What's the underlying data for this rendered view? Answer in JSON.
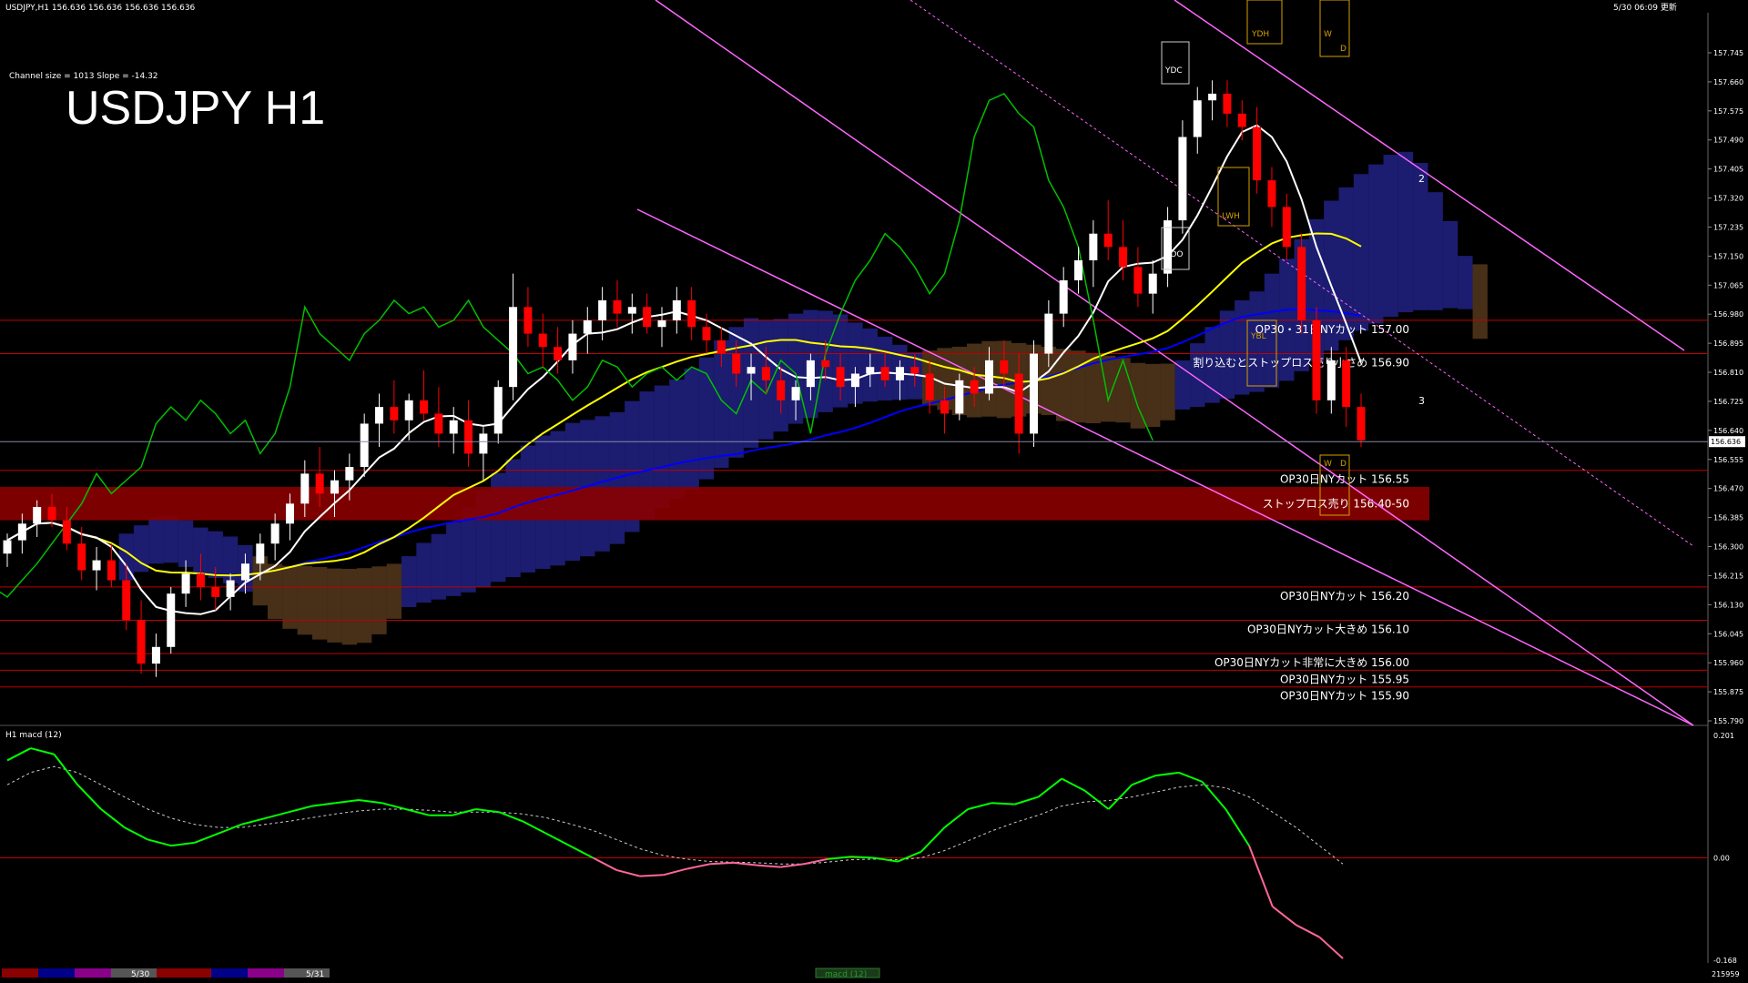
{
  "header": {
    "info_line": "USDJPY,H1  156.636 156.636 156.636 156.636",
    "timestamp": "5/30 06:09 更新"
  },
  "overlay": {
    "channel_info": "Channel size = 1013 Slope = -14.32",
    "big_title": "USDJPY H1"
  },
  "colors": {
    "background": "#000000",
    "bull_candle": "#ffffff",
    "bear_candle": "#ff0000",
    "ma_fast": "#ffffff",
    "ma_mid": "#ffff00",
    "ma_slow": "#0000ff",
    "chikou": "#00c000",
    "channel": "#ff66ff",
    "kumo_bull": "#3333cc",
    "kumo_bear": "#cc8844",
    "level_line": "#c00000",
    "stop_zone": "#8b0000",
    "macd_line_up": "#00ff00",
    "macd_line_down": "#ff6699"
  },
  "chart_data": [
    {
      "type": "candlestick",
      "symbol": "USDJPY",
      "timeframe": "H1",
      "ylim": [
        155.79,
        157.83
      ],
      "price_axis_ticks": [
        "157.745",
        "157.660",
        "157.575",
        "157.490",
        "157.405",
        "157.320",
        "157.235",
        "157.150",
        "157.065",
        "156.980",
        "156.895",
        "156.810",
        "156.725",
        "156.640",
        "156.555",
        "156.470",
        "156.385",
        "156.300",
        "156.215",
        "156.130",
        "156.045",
        "155.960",
        "155.875",
        "155.790"
      ],
      "current_price": "156.636",
      "x_labels": [
        "5/30",
        "5/31"
      ],
      "candles": [
        [
          156.3,
          156.36,
          156.26,
          156.34
        ],
        [
          156.34,
          156.42,
          156.3,
          156.39
        ],
        [
          156.39,
          156.46,
          156.35,
          156.44
        ],
        [
          156.44,
          156.48,
          156.38,
          156.4
        ],
        [
          156.4,
          156.44,
          156.31,
          156.33
        ],
        [
          156.33,
          156.38,
          156.22,
          156.25
        ],
        [
          156.25,
          156.32,
          156.19,
          156.28
        ],
        [
          156.28,
          156.33,
          156.2,
          156.22
        ],
        [
          156.22,
          156.27,
          156.07,
          156.1
        ],
        [
          156.1,
          156.16,
          155.94,
          155.97
        ],
        [
          155.97,
          156.06,
          155.93,
          156.02
        ],
        [
          156.02,
          156.2,
          156.0,
          156.18
        ],
        [
          156.18,
          156.28,
          156.14,
          156.24
        ],
        [
          156.24,
          156.3,
          156.16,
          156.2
        ],
        [
          156.2,
          156.26,
          156.13,
          156.17
        ],
        [
          156.17,
          156.24,
          156.13,
          156.22
        ],
        [
          156.22,
          156.3,
          156.18,
          156.27
        ],
        [
          156.27,
          156.36,
          156.22,
          156.33
        ],
        [
          156.33,
          156.42,
          156.28,
          156.39
        ],
        [
          156.39,
          156.48,
          156.34,
          156.45
        ],
        [
          156.45,
          156.58,
          156.41,
          156.54
        ],
        [
          156.54,
          156.62,
          156.44,
          156.48
        ],
        [
          156.48,
          156.55,
          156.41,
          156.52
        ],
        [
          156.52,
          156.6,
          156.46,
          156.56
        ],
        [
          156.56,
          156.72,
          156.53,
          156.69
        ],
        [
          156.69,
          156.78,
          156.62,
          156.74
        ],
        [
          156.74,
          156.82,
          156.66,
          156.7
        ],
        [
          156.7,
          156.78,
          156.64,
          156.76
        ],
        [
          156.76,
          156.85,
          156.7,
          156.72
        ],
        [
          156.72,
          156.8,
          156.62,
          156.66
        ],
        [
          156.66,
          156.74,
          156.6,
          156.7
        ],
        [
          156.7,
          156.76,
          156.56,
          156.6
        ],
        [
          156.6,
          156.68,
          156.52,
          156.66
        ],
        [
          156.66,
          156.82,
          156.63,
          156.8
        ],
        [
          156.8,
          157.14,
          156.76,
          157.04
        ],
        [
          157.04,
          157.1,
          156.92,
          156.96
        ],
        [
          156.96,
          157.02,
          156.86,
          156.92
        ],
        [
          156.92,
          156.98,
          156.84,
          156.88
        ],
        [
          156.88,
          157.0,
          156.84,
          156.96
        ],
        [
          156.96,
          157.04,
          156.9,
          157.0
        ],
        [
          157.0,
          157.1,
          156.94,
          157.06
        ],
        [
          157.06,
          157.12,
          156.98,
          157.02
        ],
        [
          157.02,
          157.08,
          156.96,
          157.04
        ],
        [
          157.04,
          157.08,
          156.96,
          156.98
        ],
        [
          156.98,
          157.04,
          156.92,
          157.0
        ],
        [
          157.0,
          157.1,
          156.96,
          157.06
        ],
        [
          157.06,
          157.1,
          156.94,
          156.98
        ],
        [
          156.98,
          157.02,
          156.9,
          156.94
        ],
        [
          156.94,
          156.98,
          156.86,
          156.9
        ],
        [
          156.9,
          156.94,
          156.8,
          156.84
        ],
        [
          156.84,
          156.9,
          156.76,
          156.86
        ],
        [
          156.86,
          156.92,
          156.78,
          156.82
        ],
        [
          156.82,
          156.86,
          156.72,
          156.76
        ],
        [
          156.76,
          156.82,
          156.7,
          156.8
        ],
        [
          156.8,
          156.9,
          156.76,
          156.88
        ],
        [
          156.88,
          156.94,
          156.82,
          156.86
        ],
        [
          156.86,
          156.9,
          156.76,
          156.8
        ],
        [
          156.8,
          156.86,
          156.74,
          156.84
        ],
        [
          156.84,
          156.9,
          156.8,
          156.86
        ],
        [
          156.86,
          156.9,
          156.8,
          156.82
        ],
        [
          156.82,
          156.88,
          156.76,
          156.86
        ],
        [
          156.86,
          156.9,
          156.8,
          156.84
        ],
        [
          156.84,
          156.88,
          156.72,
          156.76
        ],
        [
          156.76,
          156.8,
          156.66,
          156.72
        ],
        [
          156.72,
          156.84,
          156.7,
          156.82
        ],
        [
          156.82,
          156.86,
          156.74,
          156.78
        ],
        [
          156.78,
          156.92,
          156.76,
          156.88
        ],
        [
          156.88,
          156.94,
          156.8,
          156.84
        ],
        [
          156.84,
          156.9,
          156.6,
          156.66
        ],
        [
          156.66,
          156.94,
          156.62,
          156.9
        ],
        [
          156.9,
          157.06,
          156.86,
          157.02
        ],
        [
          157.02,
          157.16,
          156.98,
          157.12
        ],
        [
          157.12,
          157.22,
          157.08,
          157.18
        ],
        [
          157.18,
          157.3,
          157.1,
          157.26
        ],
        [
          157.26,
          157.36,
          157.18,
          157.22
        ],
        [
          157.22,
          157.3,
          157.12,
          157.16
        ],
        [
          157.16,
          157.22,
          157.04,
          157.08
        ],
        [
          157.08,
          157.18,
          157.02,
          157.14
        ],
        [
          157.14,
          157.34,
          157.1,
          157.3
        ],
        [
          157.3,
          157.6,
          157.26,
          157.55
        ],
        [
          157.55,
          157.7,
          157.5,
          157.66
        ],
        [
          157.66,
          157.72,
          157.6,
          157.68
        ],
        [
          157.68,
          157.72,
          157.58,
          157.62
        ],
        [
          157.62,
          157.66,
          157.54,
          157.58
        ],
        [
          157.58,
          157.64,
          157.38,
          157.42
        ],
        [
          157.42,
          157.46,
          157.28,
          157.34
        ],
        [
          157.34,
          157.38,
          157.18,
          157.22
        ],
        [
          157.22,
          157.26,
          156.96,
          157.0
        ],
        [
          157.0,
          157.04,
          156.72,
          156.76
        ],
        [
          156.76,
          156.92,
          156.72,
          156.88
        ],
        [
          156.88,
          156.92,
          156.68,
          156.74
        ],
        [
          156.74,
          156.78,
          156.62,
          156.64
        ]
      ]
    },
    {
      "type": "line",
      "name": "macd (12)",
      "ylim": [
        -0.168,
        0.201
      ],
      "axis_ticks": [
        "0.201",
        "0.00",
        "-0.168"
      ],
      "macd": [
        0.16,
        0.18,
        0.17,
        0.12,
        0.08,
        0.05,
        0.03,
        0.02,
        0.025,
        0.04,
        0.055,
        0.065,
        0.075,
        0.085,
        0.09,
        0.095,
        0.09,
        0.08,
        0.07,
        0.07,
        0.08,
        0.075,
        0.06,
        0.04,
        0.02,
        0.0,
        -0.02,
        -0.03,
        -0.028,
        -0.018,
        -0.01,
        -0.008,
        -0.012,
        -0.015,
        -0.01,
        -0.002,
        0.002,
        0.0,
        -0.006,
        0.01,
        0.05,
        0.08,
        0.09,
        0.088,
        0.1,
        0.13,
        0.11,
        0.08,
        0.12,
        0.135,
        0.14,
        0.125,
        0.08,
        0.02,
        -0.08,
        -0.11,
        -0.13,
        -0.165
      ],
      "signal": [
        0.12,
        0.14,
        0.15,
        0.14,
        0.12,
        0.1,
        0.08,
        0.065,
        0.055,
        0.05,
        0.05,
        0.055,
        0.06,
        0.066,
        0.072,
        0.077,
        0.08,
        0.08,
        0.078,
        0.075,
        0.075,
        0.075,
        0.072,
        0.066,
        0.056,
        0.045,
        0.03,
        0.015,
        0.004,
        -0.002,
        -0.006,
        -0.007,
        -0.008,
        -0.01,
        -0.01,
        -0.007,
        -0.003,
        -0.002,
        -0.003,
        0.0,
        0.012,
        0.028,
        0.044,
        0.058,
        0.07,
        0.085,
        0.092,
        0.094,
        0.1,
        0.108,
        0.116,
        0.12,
        0.115,
        0.1,
        0.075,
        0.05,
        0.02,
        -0.01
      ]
    }
  ],
  "price_levels": [
    {
      "price": 157.0,
      "label": "OP30・31日NYカット 157.00"
    },
    {
      "price": 156.9,
      "label": "割り込むとストップロス売り小さめ 156.90"
    },
    {
      "price": 156.55,
      "label": "OP30日NYカット 156.55"
    },
    {
      "price": 156.2,
      "label": "OP30日NYカット 156.20"
    },
    {
      "price": 156.1,
      "label": "OP30日NYカット大きめ 156.10"
    },
    {
      "price": 156.0,
      "label": "OP30日NYカット非常に大きめ 156.00"
    },
    {
      "price": 155.95,
      "label": "OP30日NYカット 155.95"
    },
    {
      "price": 155.9,
      "label": "OP30日NYカット 155.90"
    }
  ],
  "stop_zone": {
    "from": 156.4,
    "to": 156.5,
    "label": "ストップロス売り 156.40-50"
  },
  "markers": {
    "ydh": "YDH",
    "ydc_top": "YDC",
    "ydc_low": "YDO",
    "lwh": "LWH",
    "ybl": "YBL",
    "w": "W",
    "d": "D",
    "num2": "2",
    "num3": "3"
  },
  "macd_panel": {
    "title": "H1  macd (12)"
  },
  "bottom": {
    "date1": "5/30",
    "date2": "5/31",
    "macd_label": "macd (12)",
    "volume": "215959"
  }
}
